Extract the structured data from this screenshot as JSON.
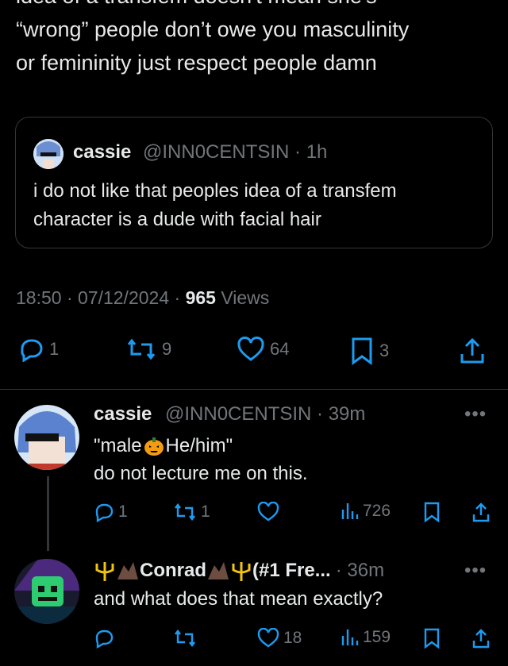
{
  "main_post": {
    "cut_line": "idea of a transfem doesn't mean she's",
    "line1": "“wrong” people don’t owe you masculinity",
    "line2": "or femininity just respect people damn"
  },
  "quoted": {
    "name": "cassie",
    "handle_time": "@INN0CENTSIN · 1h",
    "text_line1": "i do not like that peoples idea of a transfem",
    "text_line2": "character is a dude with facial hair"
  },
  "meta": {
    "time_date": "18:50 · 07/12/2024 · ",
    "views_count": "965",
    "views_label": " Views"
  },
  "actions": {
    "replies": "1",
    "reposts": "9",
    "likes": "64",
    "bookmarks": "3"
  },
  "replies": [
    {
      "name": "cassie",
      "handle_time": "@INN0CENTSIN · 39m",
      "text_part1": "\"male",
      "text_part2": "He/him\"",
      "text_line2": "do not lecture me on this.",
      "reply_count": "1",
      "repost_count": "1",
      "like_count": "",
      "views": "726"
    },
    {
      "name": "Conrad",
      "name_suffix": "(#1 Fre...",
      "handle_time": "· 36m",
      "text": "and what does that mean exactly?",
      "reply_count": "",
      "repost_count": "",
      "like_count": "18",
      "views": "159"
    }
  ],
  "colors": {
    "background": "#000000",
    "text": "#e7e9ea",
    "secondary": "#71767b",
    "accent": "#1d9bf0"
  }
}
